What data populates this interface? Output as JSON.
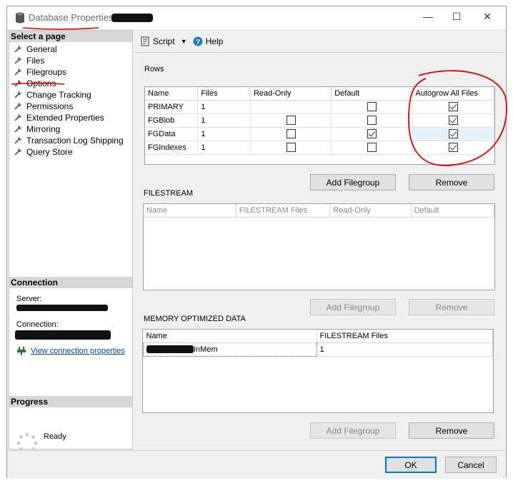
{
  "window": {
    "title": "Database Properties - ",
    "controls": {
      "minimize": "—",
      "maximize": "☐",
      "close": "✕"
    }
  },
  "left": {
    "select_page_header": "Select a page",
    "pages": [
      "General",
      "Files",
      "Filegroups",
      "Options",
      "Change Tracking",
      "Permissions",
      "Extended Properties",
      "Mirroring",
      "Transaction Log Shipping",
      "Query Store"
    ],
    "connection_header": "Connection",
    "server_label": "Server:",
    "connection_label": "Connection:",
    "view_connection_link": "View connection properties",
    "progress_header": "Progress",
    "progress_status": "Ready"
  },
  "toolbar": {
    "script_label": "Script",
    "help_label": "Help"
  },
  "rows": {
    "label": "Rows",
    "columns": [
      "Name",
      "Files",
      "Read-Only",
      "Default",
      "Autogrow All Files"
    ],
    "rows": [
      {
        "name": "PRIMARY",
        "files": "1",
        "read_only": null,
        "default": false,
        "autogrow": true
      },
      {
        "name": "FGBlob",
        "files": "1",
        "read_only": false,
        "default": false,
        "autogrow": true
      },
      {
        "name": "FGData",
        "files": "1",
        "read_only": false,
        "default": true,
        "autogrow": true
      },
      {
        "name": "FGIndexes",
        "files": "1",
        "read_only": false,
        "default": false,
        "autogrow": true
      }
    ],
    "add_button": "Add Filegroup",
    "remove_button": "Remove"
  },
  "filestream": {
    "label": "FILESTREAM",
    "columns": [
      "Name",
      "FILESTREAM Files",
      "Read-Only",
      "Default"
    ],
    "add_button": "Add Filegroup",
    "remove_button": "Remove"
  },
  "memory": {
    "label": "MEMORY OPTIMIZED DATA",
    "columns": [
      "Name",
      "FILESTREAM Files"
    ],
    "rows": [
      {
        "name_suffix": "InMem",
        "files": "1"
      }
    ],
    "add_button": "Add Filegroup",
    "remove_button": "Remove"
  },
  "footer": {
    "ok_button": "OK",
    "cancel_button": "Cancel"
  },
  "colors": {
    "annotation": "#e00000",
    "link": "#0645ad",
    "selected_row": "#e5f1fb"
  }
}
